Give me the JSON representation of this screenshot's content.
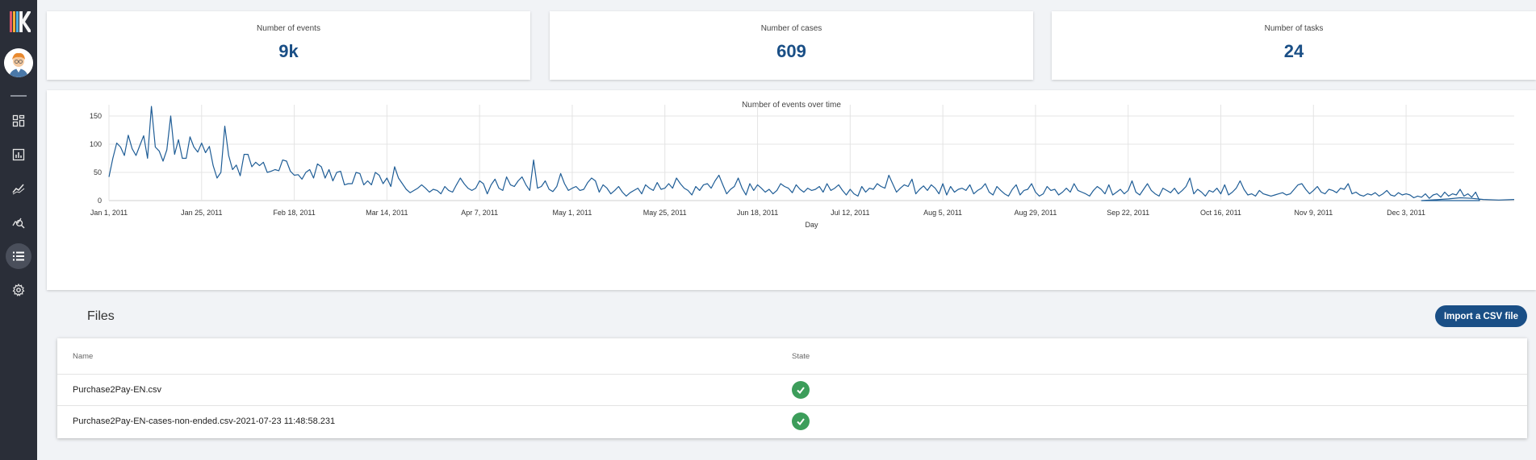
{
  "sidebar": {
    "logo": "kanban-logo",
    "items": [
      {
        "icon": "dashboard-icon",
        "active": false
      },
      {
        "icon": "bar-chart-icon",
        "active": false
      },
      {
        "icon": "trend-line-icon",
        "active": false
      },
      {
        "icon": "analytics-search-icon",
        "active": false
      },
      {
        "icon": "list-icon",
        "active": true
      },
      {
        "icon": "gear-icon",
        "active": false
      }
    ]
  },
  "stats": [
    {
      "label": "Number of events",
      "value": "9k"
    },
    {
      "label": "Number of cases",
      "value": "609"
    },
    {
      "label": "Number of tasks",
      "value": "24"
    }
  ],
  "chart_data": {
    "type": "line",
    "title": "Number of events over time",
    "xlabel": "Day",
    "ylabel": "",
    "ylim": [
      0,
      170
    ],
    "yticks": [
      0,
      50,
      100,
      150
    ],
    "xticks": [
      "Jan 1, 2011",
      "Jan 25, 2011",
      "Feb 18, 2011",
      "Mar 14, 2011",
      "Apr 7, 2011",
      "May 1, 2011",
      "May 25, 2011",
      "Jun 18, 2011",
      "Jul 12, 2011",
      "Aug 5, 2011",
      "Aug 29, 2011",
      "Sep 22, 2011",
      "Oct 16, 2011",
      "Nov 9, 2011",
      "Dec 3, 2011"
    ],
    "grid": true,
    "color": "#1f5d96",
    "series": [
      {
        "values": [
          42,
          75,
          102,
          95,
          80,
          116,
          92,
          80,
          98,
          115,
          75,
          167,
          95,
          88,
          70,
          90,
          150,
          82,
          108,
          75,
          75,
          113,
          95,
          86,
          102,
          85,
          96,
          62,
          40,
          50,
          132,
          80,
          55,
          63,
          44,
          82,
          82,
          60,
          68,
          62,
          68,
          50,
          52,
          55,
          53,
          72,
          70,
          52,
          45,
          46,
          38,
          50,
          55,
          40,
          65,
          60,
          40,
          55,
          35,
          50,
          52,
          28,
          30,
          30,
          50,
          48,
          28,
          35,
          28,
          50,
          45,
          30,
          40,
          25,
          60,
          40,
          30,
          20,
          14,
          18,
          22,
          28,
          22,
          15,
          20,
          18,
          12,
          25,
          18,
          15,
          28,
          40,
          30,
          22,
          18,
          22,
          35,
          30,
          12,
          28,
          38,
          22,
          18,
          42,
          28,
          25,
          35,
          42,
          28,
          18,
          72,
          22,
          25,
          35,
          20,
          16,
          25,
          48,
          30,
          18,
          22,
          25,
          18,
          20,
          32,
          40,
          35,
          15,
          28,
          22,
          12,
          18,
          25,
          15,
          8,
          14,
          18,
          22,
          12,
          28,
          22,
          18,
          32,
          20,
          22,
          30,
          22,
          40,
          30,
          22,
          18,
          10,
          25,
          18,
          28,
          30,
          22,
          35,
          45,
          28,
          12,
          20,
          25,
          40,
          22,
          10,
          30,
          18,
          28,
          22,
          15,
          20,
          12,
          18,
          30,
          25,
          22,
          14,
          28,
          20,
          15,
          22,
          18,
          20,
          25,
          15,
          30,
          18,
          22,
          28,
          18,
          10,
          20,
          12,
          8,
          25,
          15,
          22,
          20,
          30,
          25,
          22,
          45,
          30,
          15,
          22,
          28,
          25,
          38,
          12,
          20,
          26,
          18,
          28,
          22,
          12,
          30,
          10,
          25,
          15,
          20,
          22,
          18,
          28,
          12,
          18,
          22,
          30,
          15,
          10,
          25,
          18,
          12,
          8,
          20,
          28,
          10,
          18,
          20,
          30,
          15,
          8,
          12,
          25,
          18,
          20,
          10,
          15,
          22,
          15,
          30,
          18,
          15,
          12,
          8,
          18,
          25,
          20,
          12,
          28,
          10,
          15,
          20,
          12,
          18,
          35,
          15,
          10,
          20,
          30,
          18,
          12,
          8,
          22,
          18,
          14,
          22,
          12,
          18,
          25,
          40,
          12,
          20,
          15,
          8,
          18,
          15,
          22,
          12,
          28,
          10,
          15,
          22,
          35,
          20,
          10,
          12,
          8,
          18,
          12,
          10,
          8,
          10,
          12,
          14,
          10,
          12,
          20,
          28,
          30,
          20,
          12,
          18,
          25,
          15,
          12,
          20,
          18,
          14,
          22,
          20,
          30,
          12,
          15,
          10,
          8,
          12,
          10,
          14,
          8,
          12,
          18,
          10,
          8,
          14,
          10,
          12,
          10,
          5,
          8,
          6,
          12,
          4,
          10,
          12,
          6,
          15,
          8,
          12,
          10,
          20,
          8,
          12,
          6,
          15,
          0
        ],
        "tail": {
          "day_start": 288,
          "day_end": 364,
          "value": 0,
          "bump": [
            [
              340,
              0
            ],
            [
              347,
              3
            ],
            [
              350,
              5
            ],
            [
              353,
              4
            ],
            [
              356,
              2
            ],
            [
              360,
              1
            ],
            [
              364,
              2
            ]
          ]
        }
      }
    ]
  },
  "files": {
    "title": "Files",
    "import_label": "Import a CSV file",
    "columns": {
      "name": "Name",
      "state": "State"
    },
    "rows": [
      {
        "name": "Purchase2Pay-EN.csv",
        "state": "check-icon"
      },
      {
        "name": "Purchase2Pay-EN-cases-non-ended.csv-2021-07-23 11:48:58.231",
        "state": "check-icon"
      }
    ]
  }
}
